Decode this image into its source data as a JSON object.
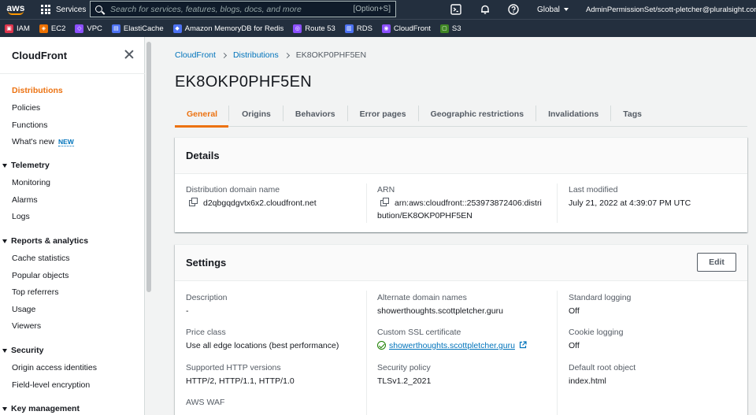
{
  "topnav": {
    "logo_text": "aws",
    "services_label": "Services",
    "search_placeholder": "Search for services, features, blogs, docs, and more",
    "search_shortcut": "[Option+S]",
    "region": "Global",
    "account": "AdminPermissionSet/scott-pletcher@pluralsight.com",
    "icons": [
      "cloudshell-icon",
      "bell-icon",
      "help-icon"
    ]
  },
  "favorites": [
    {
      "label": "IAM",
      "color": "#dd344c"
    },
    {
      "label": "EC2",
      "color": "#ed7100"
    },
    {
      "label": "VPC",
      "color": "#8c4fff"
    },
    {
      "label": "ElastiCache",
      "color": "#4d72f3"
    },
    {
      "label": "Amazon MemoryDB for Redis",
      "color": "#4d72f3"
    },
    {
      "label": "Route 53",
      "color": "#8c4fff"
    },
    {
      "label": "RDS",
      "color": "#4d72f3"
    },
    {
      "label": "CloudFront",
      "color": "#8c4fff"
    },
    {
      "label": "S3",
      "color": "#3f8624"
    }
  ],
  "sidebar": {
    "title": "CloudFront",
    "items": {
      "distributions": "Distributions",
      "policies": "Policies",
      "functions": "Functions",
      "whats_new": "What's new",
      "new_badge": "NEW",
      "monitoring": "Monitoring",
      "alarms": "Alarms",
      "logs": "Logs",
      "cache_statistics": "Cache statistics",
      "popular_objects": "Popular objects",
      "top_referrers": "Top referrers",
      "usage": "Usage",
      "viewers": "Viewers",
      "origin_access_identities": "Origin access identities",
      "field_level_encryption": "Field-level encryption"
    },
    "sections": {
      "telemetry": "Telemetry",
      "reports": "Reports & analytics",
      "security": "Security",
      "key_management": "Key management"
    }
  },
  "breadcrumb": {
    "root": "CloudFront",
    "parent": "Distributions",
    "current": "EK8OKP0PHF5EN"
  },
  "page_title": "EK8OKP0PHF5EN",
  "tabs": [
    "General",
    "Origins",
    "Behaviors",
    "Error pages",
    "Geographic restrictions",
    "Invalidations",
    "Tags"
  ],
  "details": {
    "title": "Details",
    "domain_label": "Distribution domain name",
    "domain_value": "d2qbgqdgvtx6x2.cloudfront.net",
    "arn_label": "ARN",
    "arn_line1": "arn:aws:cloudfront::253973872406:distri",
    "arn_line2": "bution/EK8OKP0PHF5EN",
    "modified_label": "Last modified",
    "modified_value": "July 21, 2022 at 4:39:07 PM UTC"
  },
  "settings": {
    "title": "Settings",
    "edit_label": "Edit",
    "description_label": "Description",
    "description_value": "-",
    "price_class_label": "Price class",
    "price_class_value": "Use all edge locations (best performance)",
    "http_versions_label": "Supported HTTP versions",
    "http_versions_value": "HTTP/2, HTTP/1.1, HTTP/1.0",
    "waf_label": "AWS WAF",
    "alt_domain_label": "Alternate domain names",
    "alt_domain_value": "showerthoughts.scottpletcher.guru",
    "ssl_label": "Custom SSL certificate",
    "ssl_value": "showerthoughts.scottpletcher.guru",
    "security_policy_label": "Security policy",
    "security_policy_value": "TLSv1.2_2021",
    "std_logging_label": "Standard logging",
    "std_logging_value": "Off",
    "cookie_logging_label": "Cookie logging",
    "cookie_logging_value": "Off",
    "root_object_label": "Default root object",
    "root_object_value": "index.html"
  }
}
